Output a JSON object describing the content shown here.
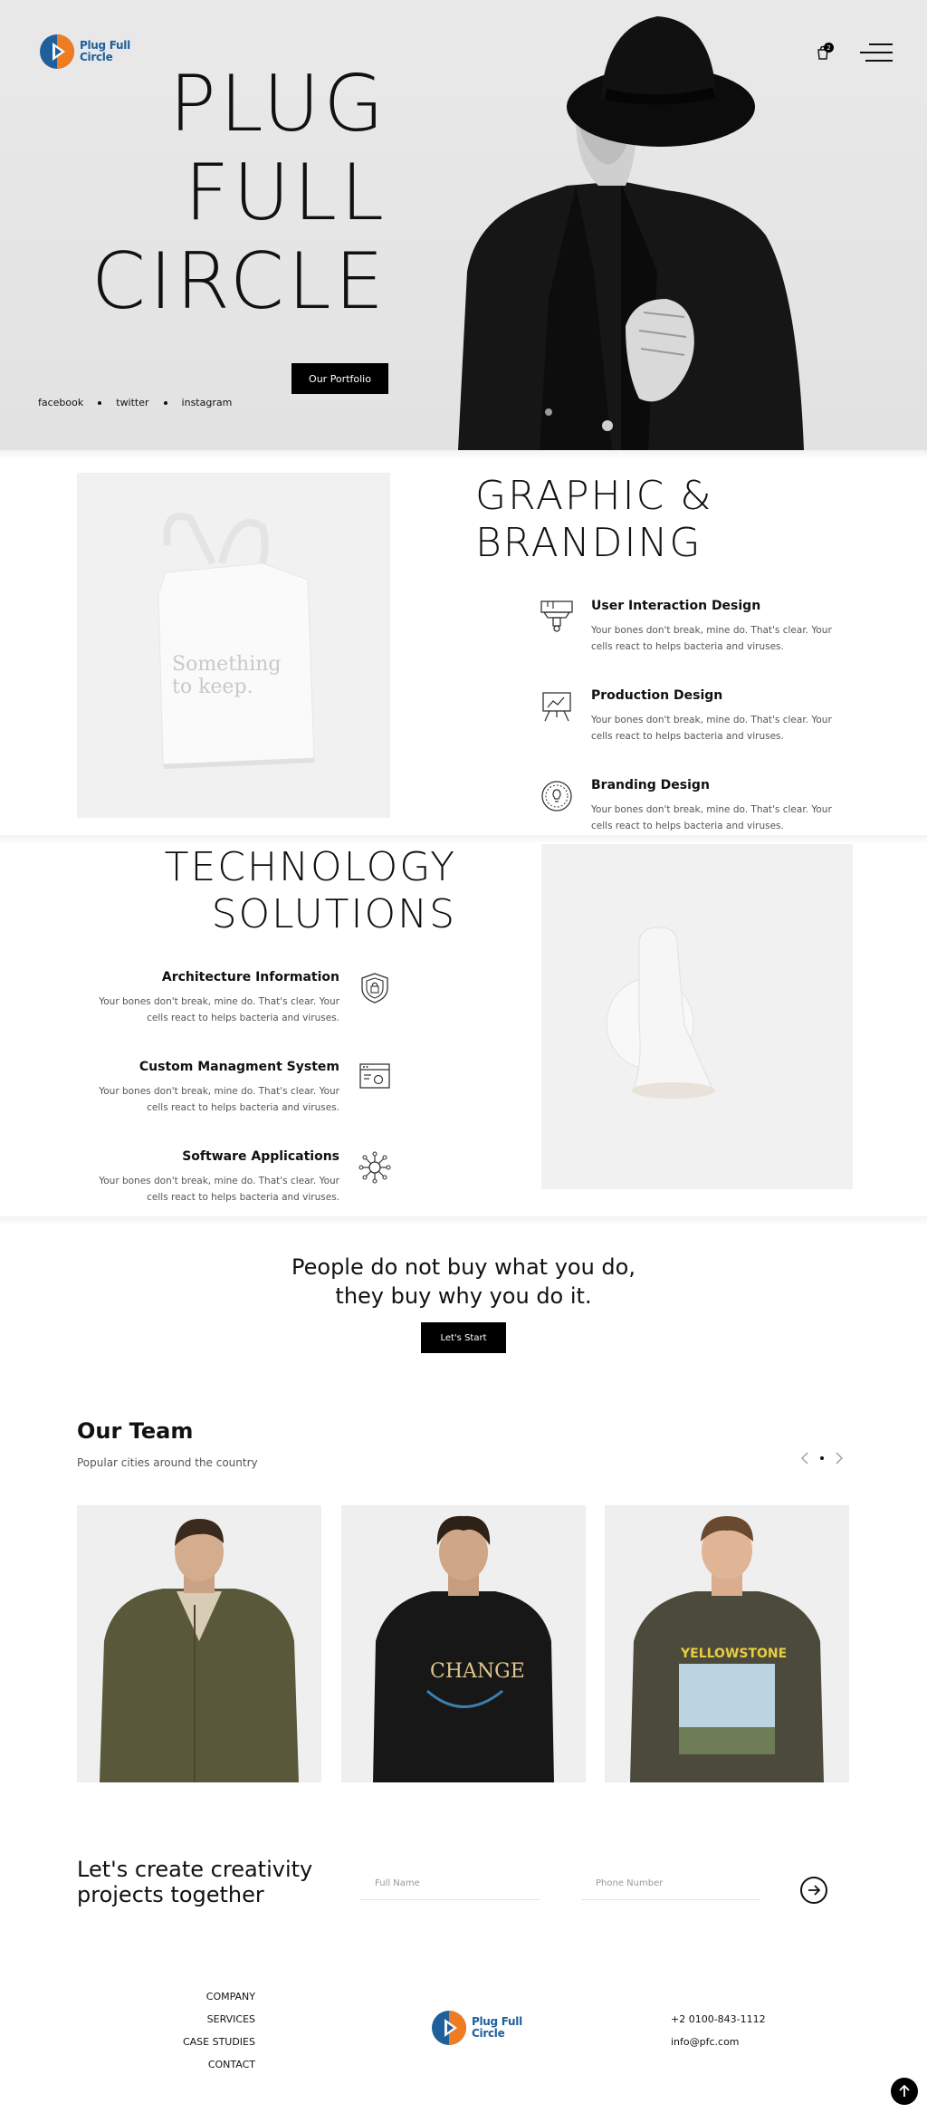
{
  "brand": {
    "name": "Plug Full Circle",
    "logo_line1": "Plug Full",
    "logo_line2": "Circle",
    "colors": {
      "primary_blue": "#1e5f9c",
      "accent_orange": "#ef7b23"
    }
  },
  "header": {
    "cart_count": "2",
    "cart_icon": "shopping-bag-icon",
    "menu_icon": "hamburger-menu-icon"
  },
  "hero": {
    "title_lines": [
      "PLUG",
      "FULL",
      "CIRCLE"
    ],
    "cta_label": "Our Portfolio",
    "socials": [
      "facebook",
      "twitter",
      "instagram"
    ]
  },
  "graphic_branding": {
    "title_lines": [
      "GRAPHIC &",
      "BRANDING"
    ],
    "bag_text_line1": "Something",
    "bag_text_line2": "to keep.",
    "features": [
      {
        "title": "User Interaction Design",
        "text": "Your bones don't break, mine do. That's clear. Your cells react to helps bacteria and viruses.",
        "icon": "paint-brush-icon"
      },
      {
        "title": "Production Design",
        "text": "Your bones don't break, mine do. That's clear. Your cells react to helps bacteria and viruses.",
        "icon": "presentation-board-icon"
      },
      {
        "title": "Branding Design",
        "text": "Your bones don't break, mine do. That's clear. Your cells react to helps bacteria and viruses.",
        "icon": "lightbulb-badge-icon"
      }
    ]
  },
  "technology": {
    "title_lines": [
      "TECHNOLOGY",
      "SOLUTIONS"
    ],
    "features": [
      {
        "title": "Architecture Information",
        "text": "Your bones don't break, mine do. That's clear. Your cells react to helps bacteria and viruses.",
        "icon": "shield-icon"
      },
      {
        "title": "Custom Managment System",
        "text": "Your bones don't break, mine do. That's clear. Your cells react to helps bacteria and viruses.",
        "icon": "browser-gear-icon"
      },
      {
        "title": "Software Applications",
        "text": "Your bones don't break, mine do. That's clear. Your cells react to helps bacteria and viruses.",
        "icon": "network-nodes-icon"
      }
    ]
  },
  "quote": {
    "line1": "People do not buy what you do,",
    "line2": "they buy why you do it.",
    "cta_label": "Let's Start"
  },
  "team": {
    "title": "Our Team",
    "subtitle": "Popular cities around the country",
    "shirt_texts": [
      "CHANGE",
      "YELLOWSTONE"
    ]
  },
  "contact": {
    "headline_line1": "Let's create creativity",
    "headline_line2": "projects together",
    "full_name_placeholder": "Full Name",
    "phone_placeholder": "Phone Number",
    "send_icon": "arrow-right-circle-icon"
  },
  "footer": {
    "links": [
      "COMPANY",
      "SERVICES",
      "CASE STUDIES",
      "CONTACT"
    ],
    "phone": "+2 0100-843-1112",
    "email": "info@pfc.com",
    "to_top_icon": "arrow-up-icon"
  }
}
